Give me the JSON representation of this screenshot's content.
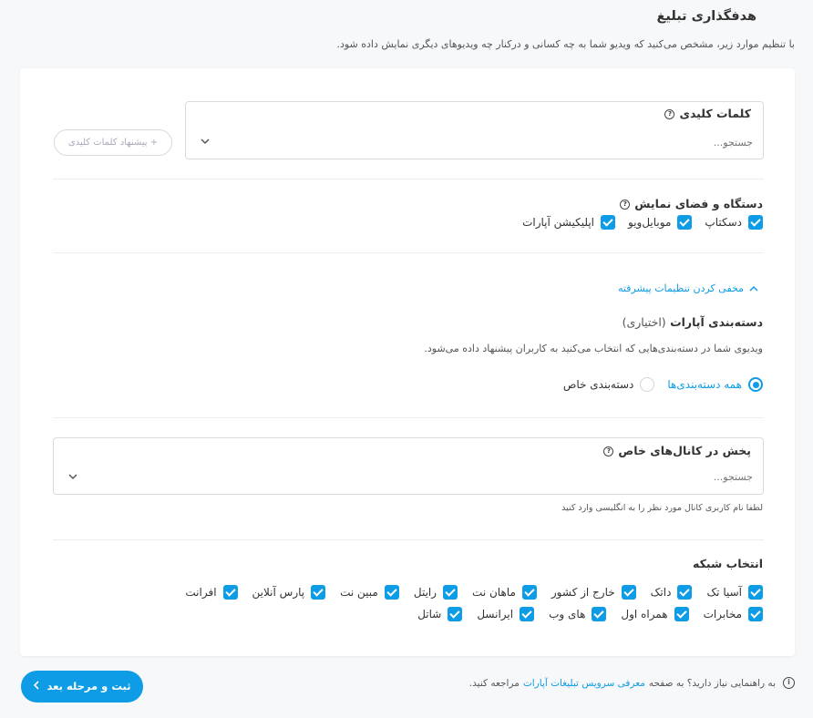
{
  "page": {
    "title": "هدفگذاری تبلیغ",
    "description": "با تنظیم موارد زیر، مشخص می‌کنید که ویدیو شما به چه کسانی و درکنار چه ویدیوهای دیگری نمایش داده شود."
  },
  "keywords": {
    "label": "کلمات کلیدی",
    "placeholder": "جستجو...",
    "suggest_button": "+ پیشنهاد کلمات کلیدی"
  },
  "devices": {
    "title": "دستگاه و فضای نمایش",
    "items": [
      "دسکتاپ",
      "موبایل‌ویو",
      "اپلیکیشن آپارات"
    ]
  },
  "advanced": {
    "toggle_label": "مخفی کردن تنظیمات پیشرفته",
    "category_title": "دسته‌بندی آپارات",
    "category_optional": "(اختیاری)",
    "category_desc": "ویدیوی شما در دسته‌بندی‌هایی که انتخاب می‌کنید به کاربران پیشنهاد داده می‌شود.",
    "radio_all": "همه دسته‌بندی‌ها",
    "radio_custom": "دسته‌بندی خاص",
    "radio_selected": "همه دسته‌بندی‌ها"
  },
  "channels": {
    "label": "پخش در کانال‌های خاص",
    "placeholder": "جستجو...",
    "hint": "لطفا نام کاربری کانال مورد نظر را به انگلیسی وارد کنید"
  },
  "network": {
    "title": "انتخاب شبکه",
    "row1": [
      "آسیا تک",
      "داتک",
      "خارج از کشور",
      "ماهان نت",
      "رایتل",
      "مبین نت",
      "پارس آنلاین",
      "افرانت"
    ],
    "row2": [
      "مخابرات",
      "همراه اول",
      "های وب",
      "ایرانسل",
      "شاتل"
    ]
  },
  "footer": {
    "prefix": "به راهنمایی نیاز دارید؟ به صفحه",
    "link": "معرفی سرویس تبلیغات آپارات",
    "suffix": "مراجعه کنید.",
    "next_button": "ثبت و مرحله بعد"
  },
  "colors": {
    "accent": "#0e9ce6",
    "background": "#f7f8fa",
    "card": "#ffffff"
  }
}
